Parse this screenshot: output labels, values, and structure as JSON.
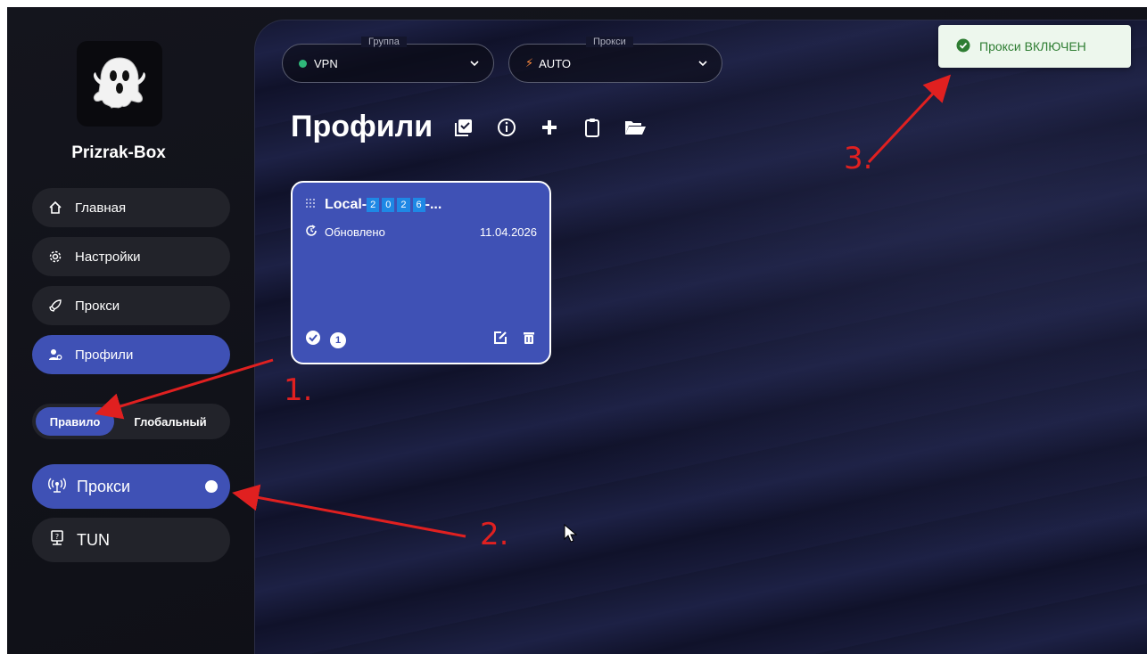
{
  "sidebar": {
    "app_name": "Prizrak-Box",
    "nav": [
      {
        "label": "Главная",
        "icon": "home-icon"
      },
      {
        "label": "Настройки",
        "icon": "gear-icon"
      },
      {
        "label": "Прокси",
        "icon": "rocket-icon"
      },
      {
        "label": "Профили",
        "icon": "user-settings-icon"
      }
    ],
    "mode": {
      "selected": "Правило",
      "other": "Глобальный"
    },
    "toggles": [
      {
        "label": "Прокси",
        "icon": "antenna-icon",
        "state": "on"
      },
      {
        "label": "TUN",
        "icon": "monitor-icon",
        "state": "off"
      }
    ]
  },
  "header": {
    "group_select": {
      "label": "Группа",
      "value": "VPN",
      "status_color": "#2fb87a"
    },
    "proxy_select": {
      "label": "Прокси",
      "value": "AUTO"
    }
  },
  "main": {
    "title": "Профили",
    "profile_card": {
      "name_prefix": "Local-",
      "name_digits": [
        "2",
        "0",
        "2",
        "6"
      ],
      "name_suffix": "-...",
      "updated_label": "Обновлено",
      "updated_date": "11.04.2026",
      "count_badge": "1"
    }
  },
  "toast": {
    "text": "Прокси ВКЛЮЧЕН"
  },
  "annotations": [
    "1.",
    "2.",
    "3."
  ],
  "colors": {
    "accent": "#3f51b5",
    "success": "#2fb87a",
    "annotation": "#e02020"
  }
}
